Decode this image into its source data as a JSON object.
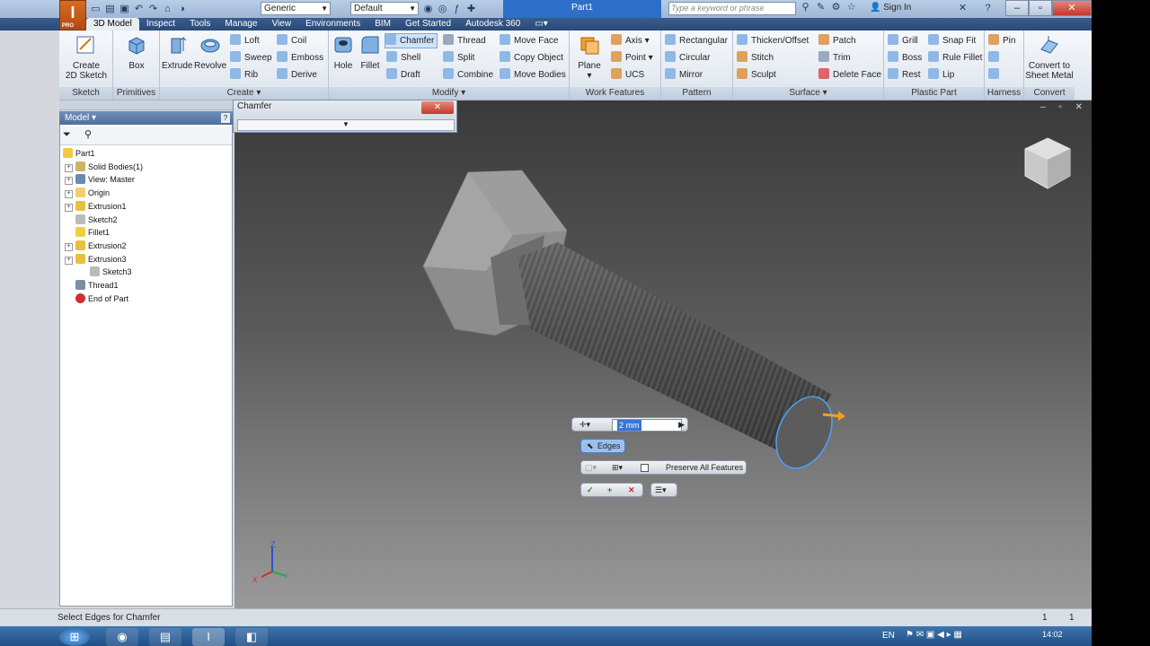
{
  "titlebar": {
    "app_letter": "I",
    "app_sub": "PRO",
    "material_combo": "Generic",
    "appearance_combo": "Default",
    "document_title": "Part1",
    "search_placeholder": "Type a keyword or phrase",
    "sign_in": "Sign In"
  },
  "tabs": [
    "3D Model",
    "Inspect",
    "Tools",
    "Manage",
    "View",
    "Environments",
    "BIM",
    "Get Started",
    "Autodesk 360"
  ],
  "ribbon": {
    "sketch": {
      "title": "Sketch",
      "create_label": "Create\n2D Sketch"
    },
    "primitives": {
      "title": "Primitives",
      "box": "Box"
    },
    "create": {
      "title": "Create",
      "extrude": "Extrude",
      "revolve": "Revolve",
      "loft": "Loft",
      "sweep": "Sweep",
      "rib": "Rib",
      "coil": "Coil",
      "emboss": "Emboss",
      "derive": "Derive"
    },
    "modify": {
      "title": "Modify",
      "hole": "Hole",
      "fillet": "Fillet",
      "chamfer": "Chamfer",
      "shell": "Shell",
      "draft": "Draft",
      "thread": "Thread",
      "split": "Split",
      "combine": "Combine",
      "move_face": "Move Face",
      "copy_object": "Copy Object",
      "move_bodies": "Move Bodies"
    },
    "work_features": {
      "title": "Work Features",
      "plane": "Plane",
      "axis": "Axis",
      "point": "Point",
      "ucs": "UCS"
    },
    "pattern": {
      "title": "Pattern",
      "rectangular": "Rectangular",
      "circular": "Circular",
      "mirror": "Mirror"
    },
    "surface": {
      "title": "Surface",
      "thicken": "Thicken/Offset",
      "stitch": "Stitch",
      "sculpt": "Sculpt",
      "patch": "Patch",
      "trim": "Trim",
      "delete_face": "Delete Face"
    },
    "plastic": {
      "title": "Plastic Part",
      "grill": "Grill",
      "boss": "Boss",
      "rest": "Rest",
      "snap_fit": "Snap Fit",
      "rule_fillet": "Rule Fillet",
      "lip": "Lip"
    },
    "harness": {
      "title": "Harness",
      "pin": "Pin"
    },
    "convert": {
      "title": "Convert",
      "label": "Convert to\nSheet Metal"
    }
  },
  "browser": {
    "title": "Model",
    "tree": [
      {
        "label": "Part1",
        "indent": 0,
        "icon": "part-icon"
      },
      {
        "label": "Solid Bodies(1)",
        "indent": 1,
        "icon": "solid-bodies-icon"
      },
      {
        "label": "View: Master",
        "indent": 1,
        "icon": "view-icon"
      },
      {
        "label": "Origin",
        "indent": 1,
        "icon": "folder-icon"
      },
      {
        "label": "Extrusion1",
        "indent": 1,
        "icon": "extrusion-icon"
      },
      {
        "label": "Sketch2",
        "indent": 1,
        "icon": "sketch-icon"
      },
      {
        "label": "Fillet1",
        "indent": 1,
        "icon": "fillet-icon"
      },
      {
        "label": "Extrusion2",
        "indent": 1,
        "icon": "extrusion-icon"
      },
      {
        "label": "Extrusion3",
        "indent": 1,
        "icon": "extrusion-icon"
      },
      {
        "label": "Sketch3",
        "indent": 2,
        "icon": "sketch-icon"
      },
      {
        "label": "Thread1",
        "indent": 1,
        "icon": "thread-icon"
      },
      {
        "label": "End of Part",
        "indent": 1,
        "icon": "end-of-part-icon"
      }
    ]
  },
  "chamfer_dialog": {
    "title": "Chamfer",
    "close": "✕"
  },
  "minitoolbar": {
    "distance": "2 mm",
    "edges": "Edges",
    "preserve": "Preserve All Features"
  },
  "statusbar": {
    "prompt": "Select Edges for Chamfer",
    "count1": "1",
    "count2": "1"
  },
  "taskbar": {
    "lang": "EN",
    "time": "14:02"
  }
}
